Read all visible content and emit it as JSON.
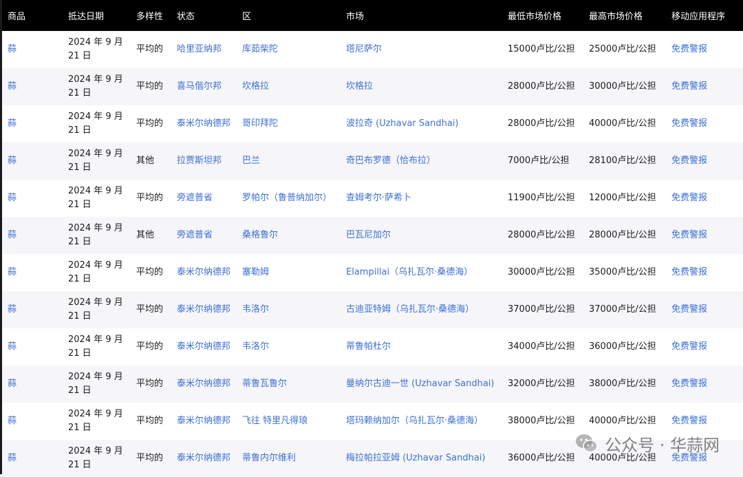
{
  "table": {
    "headers": [
      "商品",
      "抵达日期",
      "多样性",
      "状态",
      "区",
      "市场",
      "最低市场价格",
      "最高市场价格",
      "移动应用程序"
    ],
    "rows": [
      {
        "commodity": "蒜",
        "date_1": "2024 年 9 月",
        "date_2": "21 日",
        "variety": "平均的",
        "state": "哈里亚纳邦",
        "district": "库茹柴陀",
        "market": "塔尼萨尔",
        "min_price": "15000卢比/公担",
        "max_price": "25000卢比/公担",
        "app": "免费警报"
      },
      {
        "commodity": "蒜",
        "date_1": "2024 年 9 月",
        "date_2": "21 日",
        "variety": "平均的",
        "state": "喜马偕尔邦",
        "district": "坎格拉",
        "market": "坎格拉",
        "min_price": "28000卢比/公担",
        "max_price": "30000卢比/公担",
        "app": "免费警报"
      },
      {
        "commodity": "蒜",
        "date_1": "2024 年 9 月",
        "date_2": "21 日",
        "variety": "平均的",
        "state": "泰米尔纳德邦",
        "district": "哥印拜陀",
        "market": "波拉奇 (Uzhavar Sandhai)",
        "min_price": "28000卢比/公担",
        "max_price": "40000卢比/公担",
        "app": "免费警报"
      },
      {
        "commodity": "蒜",
        "date_1": "2024 年 9 月",
        "date_2": "21 日",
        "variety": "其他",
        "state": "拉贾斯坦邦",
        "district": "巴兰",
        "market": "奇巴布罗德（恰布拉）",
        "min_price": "7000卢比/公担",
        "max_price": "28100卢比/公担",
        "app": "免费警报"
      },
      {
        "commodity": "蒜",
        "date_1": "2024 年 9 月",
        "date_2": "21 日",
        "variety": "平均的",
        "state": "旁遮普省",
        "district": "罗帕尔（鲁普纳加尔）",
        "market": "查姆考尔·萨希卜",
        "min_price": "11900卢比/公担",
        "max_price": "12000卢比/公担",
        "app": "免费警报"
      },
      {
        "commodity": "蒜",
        "date_1": "2024 年 9 月",
        "date_2": "21 日",
        "variety": "其他",
        "state": "旁遮普省",
        "district": "桑格鲁尔",
        "market": "巴瓦尼加尔",
        "min_price": "28000卢比/公担",
        "max_price": "28000卢比/公担",
        "app": "免费警报"
      },
      {
        "commodity": "蒜",
        "date_1": "2024 年 9 月",
        "date_2": "21 日",
        "variety": "平均的",
        "state": "泰米尔纳德邦",
        "district": "塞勒姆",
        "market": "Elampillai（乌扎瓦尔·桑德海）",
        "min_price": "30000卢比/公担",
        "max_price": "35000卢比/公担",
        "app": "免费警报"
      },
      {
        "commodity": "蒜",
        "date_1": "2024 年 9 月",
        "date_2": "21 日",
        "variety": "平均的",
        "state": "泰米尔纳德邦",
        "district": "韦洛尔",
        "market": "古迪亚特姆（乌扎瓦尔·桑德海）",
        "min_price": "37000卢比/公担",
        "max_price": "37000卢比/公担",
        "app": "免费警报"
      },
      {
        "commodity": "蒜",
        "date_1": "2024 年 9 月",
        "date_2": "21 日",
        "variety": "平均的",
        "state": "泰米尔纳德邦",
        "district": "韦洛尔",
        "market": "蒂鲁帕杜尔",
        "min_price": "34000卢比/公担",
        "max_price": "36000卢比/公担",
        "app": "免费警报"
      },
      {
        "commodity": "蒜",
        "date_1": "2024 年 9 月",
        "date_2": "21 日",
        "variety": "平均的",
        "state": "泰米尔纳德邦",
        "district": "蒂鲁瓦鲁尔",
        "market": "曼纳尔古迪一世 (Uzhavar Sandhai)",
        "min_price": "32000卢比/公担",
        "max_price": "38000卢比/公担",
        "app": "免费警报"
      },
      {
        "commodity": "蒜",
        "date_1": "2024 年 9 月",
        "date_2": "21 日",
        "variety": "平均的",
        "state": "泰米尔纳德邦",
        "district": "飞往 特里凡得琅",
        "market": "塔玛赖纳加尔（乌扎瓦尔·桑德海）",
        "min_price": "38000卢比/公担",
        "max_price": "40000卢比/公担",
        "app": "免费警报"
      },
      {
        "commodity": "蒜",
        "date_1": "2024 年 9 月",
        "date_2": "21 日",
        "variety": "平均的",
        "state": "泰米尔纳德邦",
        "district": "蒂鲁内尔维利",
        "market": "梅拉帕拉亚姆 (Uzhavar Sandhai)",
        "min_price": "36000卢比/公担",
        "max_price": "40000卢比/公担",
        "app": "免费警报"
      }
    ]
  },
  "watermark": {
    "text": "公众号 · 华蒜网",
    "icon": "wechat-icon"
  }
}
